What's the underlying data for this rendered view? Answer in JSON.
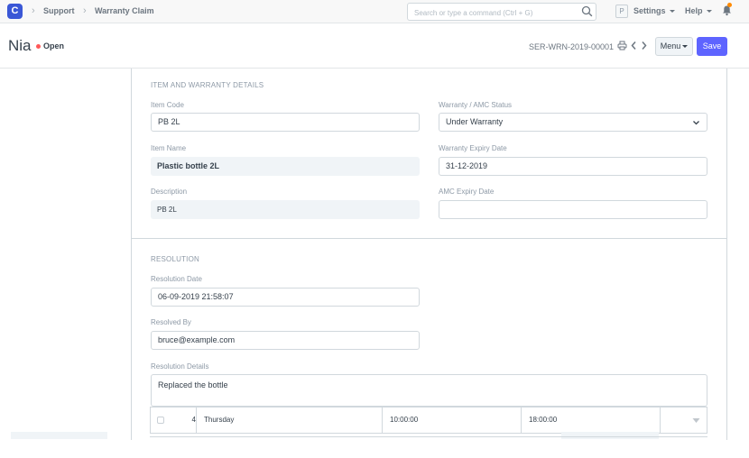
{
  "navbar": {
    "logo_letter": "C",
    "breadcrumbs": [
      "Support",
      "Warranty Claim"
    ],
    "search_placeholder": "Search or type a command (Ctrl + G)",
    "avatar_letter": "P",
    "settings_label": "Settings",
    "help_label": "Help",
    "notification_color": "#ff8a00"
  },
  "page_head": {
    "title": "Nia",
    "status": "Open",
    "status_color": "#ff5858",
    "doc_name": "SER-WRN-2019-00001",
    "menu_label": "Menu",
    "save_label": "Save",
    "primary_color": "#5e64ff"
  },
  "item_section": {
    "heading": "ITEM AND WARRANTY DETAILS",
    "item_code": {
      "label": "Item Code",
      "value": "PB 2L"
    },
    "item_name": {
      "label": "Item Name",
      "value": "Plastic bottle 2L"
    },
    "description": {
      "label": "Description",
      "value": "PB 2L"
    },
    "warranty_status": {
      "label": "Warranty / AMC Status",
      "value": "Under Warranty"
    },
    "warranty_expiry": {
      "label": "Warranty Expiry Date",
      "value": "31-12-2019"
    },
    "amc_expiry": {
      "label": "AMC Expiry Date",
      "value": ""
    }
  },
  "resolution_section": {
    "heading": "RESOLUTION",
    "resolution_date": {
      "label": "Resolution Date",
      "value": "06-09-2019 21:58:07"
    },
    "resolved_by": {
      "label": "Resolved By",
      "value": "bruce@example.com"
    },
    "resolution_details": {
      "label": "Resolution Details",
      "value": "Replaced the bottle"
    }
  },
  "grid_row": {
    "idx": "4",
    "day": "Thursday",
    "start_time": "10:00:00",
    "end_time": "18:00:00"
  }
}
